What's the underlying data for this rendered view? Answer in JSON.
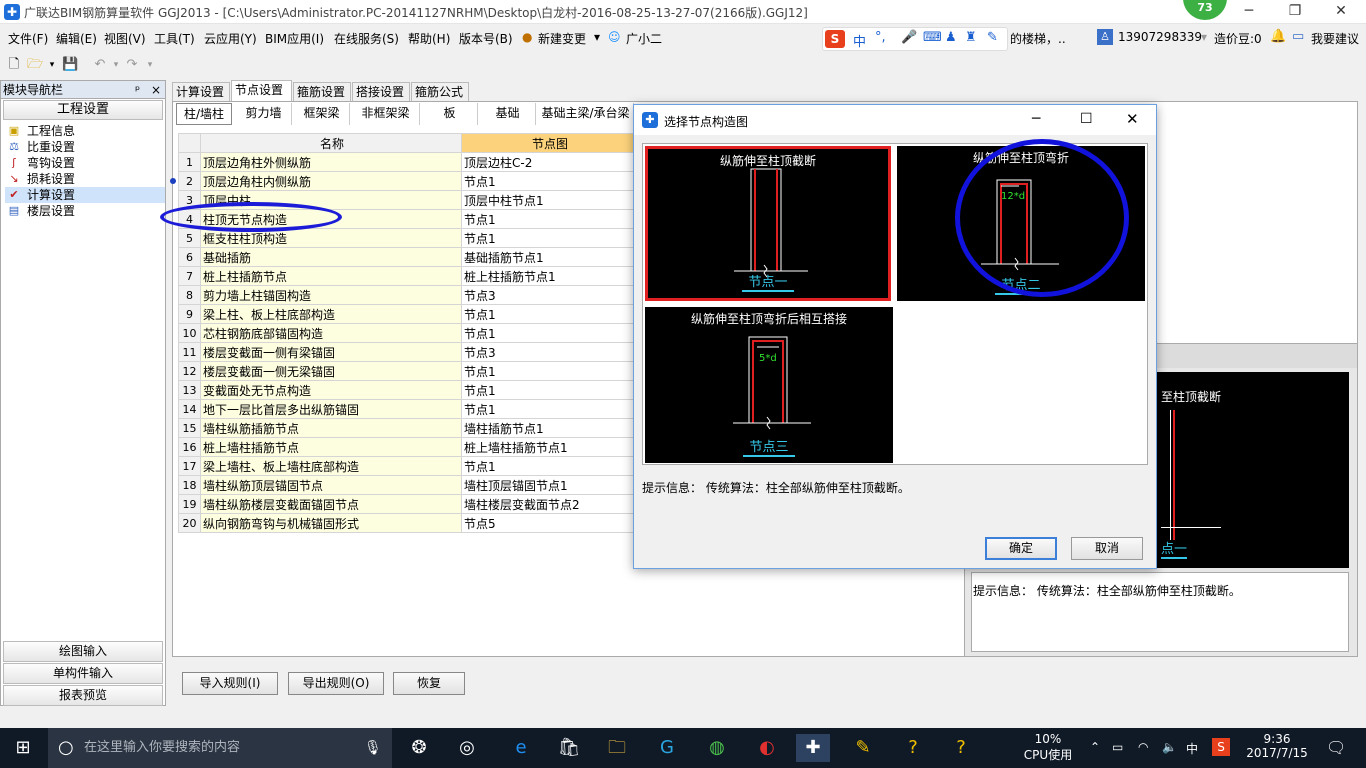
{
  "window": {
    "title": "广联达BIM钢筋算量软件 GGJ2013 - [C:\\Users\\Administrator.PC-20141127NRHM\\Desktop\\白龙村-2016-08-25-13-27-07(2166版).GGJ12]",
    "badge": "73"
  },
  "menu": [
    "文件(F)",
    "编辑(E)",
    "视图(V)",
    "工具(T)",
    "云应用(Y)",
    "BIM应用(I)",
    "在线服务(S)",
    "帮助(H)",
    "版本号(B)",
    "新建变更",
    "广小二"
  ],
  "menu_right": {
    "ime_text": "中",
    "stairs_text": "的楼梯，..",
    "phone": "13907298339",
    "cost_bean": "造价豆:0",
    "suggest": "我要建议"
  },
  "nav": {
    "header": "模块导航栏",
    "pin": "ᵖ",
    "close": "×",
    "section": "工程设置",
    "items": [
      {
        "label": "工程信息",
        "icon": "folder-icon"
      },
      {
        "label": "比重设置",
        "icon": "scale-icon"
      },
      {
        "label": "弯钩设置",
        "icon": "hook-icon"
      },
      {
        "label": "损耗设置",
        "icon": "loss-icon"
      },
      {
        "label": "计算设置",
        "icon": "calc-icon"
      },
      {
        "label": "楼层设置",
        "icon": "floor-icon"
      }
    ],
    "bottom": [
      "绘图输入",
      "单构件输入",
      "报表预览"
    ]
  },
  "tabs_top": [
    "计算设置",
    "节点设置",
    "箍筋设置",
    "搭接设置",
    "箍筋公式"
  ],
  "tabs_sub": [
    "柱/墙柱",
    "剪力墙",
    "框架梁",
    "非框架梁",
    "板",
    "基础",
    "基础主梁/承台梁"
  ],
  "grid": {
    "col_name": "名称",
    "col_node": "节点图",
    "rows": [
      {
        "n": "1",
        "name": "顶层边角柱外侧纵筋",
        "val": "顶层边柱C-2"
      },
      {
        "n": "2",
        "name": "顶层边角柱内侧纵筋",
        "val": "节点1"
      },
      {
        "n": "3",
        "name": "顶层中柱",
        "val": "顶层中柱节点1"
      },
      {
        "n": "4",
        "name": "柱顶无节点构造",
        "val": "节点1"
      },
      {
        "n": "5",
        "name": "框支柱柱顶构造",
        "val": "节点1"
      },
      {
        "n": "6",
        "name": "基础插筋",
        "val": "基础插筋节点1"
      },
      {
        "n": "7",
        "name": "桩上柱插筋节点",
        "val": "桩上柱插筋节点1"
      },
      {
        "n": "8",
        "name": "剪力墙上柱锚固构造",
        "val": "节点3"
      },
      {
        "n": "9",
        "name": "梁上柱、板上柱底部构造",
        "val": "节点1"
      },
      {
        "n": "10",
        "name": "芯柱钢筋底部锚固构造",
        "val": "节点1"
      },
      {
        "n": "11",
        "name": "楼层变截面一侧有梁锚固",
        "val": "节点3"
      },
      {
        "n": "12",
        "name": "楼层变截面一侧无梁锚固",
        "val": "节点1"
      },
      {
        "n": "13",
        "name": "变截面处无节点构造",
        "val": "节点1"
      },
      {
        "n": "14",
        "name": "地下一层比首层多出纵筋锚固",
        "val": "节点1"
      },
      {
        "n": "15",
        "name": "墙柱纵筋插筋节点",
        "val": "墙柱插筋节点1"
      },
      {
        "n": "16",
        "name": "桩上墙柱插筋节点",
        "val": "桩上墙柱插筋节点1"
      },
      {
        "n": "17",
        "name": "梁上墙柱、板上墙柱底部构造",
        "val": "节点1"
      },
      {
        "n": "18",
        "name": "墙柱纵筋顶层锚固节点",
        "val": "墙柱顶层锚固节点1"
      },
      {
        "n": "19",
        "name": "墙柱纵筋楼层变截面锚固节点",
        "val": "墙柱楼层变截面节点2"
      },
      {
        "n": "20",
        "name": "纵向钢筋弯钩与机械锚固形式",
        "val": "节点5"
      }
    ]
  },
  "right_panel": {
    "caption": "至柱顶截断",
    "node_label": "点一",
    "hint": "提示信息：  传统算法：柱全部纵筋伸至柱顶截断。"
  },
  "bottom_buttons": [
    "导入规则(I)",
    "导出规则(O)",
    "恢复"
  ],
  "dialog": {
    "title": "选择节点构造图",
    "thumbs": [
      {
        "caption": "纵筋伸至柱顶截断",
        "label": "节点一",
        "dim": ""
      },
      {
        "caption": "纵筋伸至柱顶弯折",
        "label": "节点二",
        "dim": "12*d"
      },
      {
        "caption": "纵筋伸至柱顶弯折后相互搭接",
        "label": "节点三",
        "dim": "5*d"
      }
    ],
    "hint": "提示信息：  传统算法：柱全部纵筋伸至柱顶截断。",
    "ok": "确定",
    "cancel": "取消"
  },
  "taskbar": {
    "search_placeholder": "在这里输入你要搜索的内容",
    "cpu_pct": "10%",
    "cpu_label": "CPU使用",
    "ime": "中",
    "time": "9:36",
    "date": "2017/7/15"
  },
  "colors": {
    "highlight_red": "#e02020",
    "annotation_blue": "#1c1cd8",
    "rebar_red": "#e02020",
    "label_cyan": "#36c8e8",
    "dim_green": "#30e030"
  }
}
